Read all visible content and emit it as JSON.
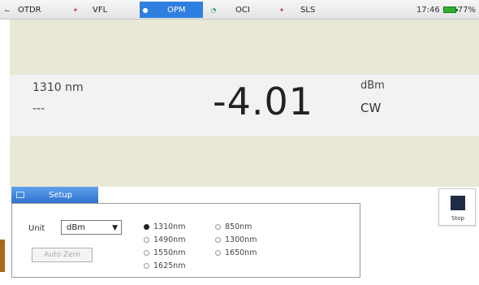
{
  "tabs": [
    {
      "label": "OTDR",
      "icon": "otdr-icon"
    },
    {
      "label": "VFL",
      "icon": "laser-icon"
    },
    {
      "label": "OPM",
      "icon": "power-meter-icon",
      "active": true
    },
    {
      "label": "OCI",
      "icon": "inspection-icon"
    },
    {
      "label": "SLS",
      "icon": "light-source-icon"
    }
  ],
  "status": {
    "time": "17:46",
    "battery": "77%"
  },
  "reading": {
    "wavelength": "1310 nm",
    "secondary": "---",
    "value": "-4.01",
    "unit": "dBm",
    "mode": "CW"
  },
  "setup": {
    "title": "Setup",
    "unit_label": "Unit",
    "unit_value": "dBm",
    "auto_zero": "Auto Zero",
    "wavelengths": [
      {
        "label": "1310nm",
        "checked": true
      },
      {
        "label": "1490nm",
        "checked": false
      },
      {
        "label": "1550nm",
        "checked": false
      },
      {
        "label": "1625nm",
        "checked": false
      },
      {
        "label": "850nm",
        "checked": false
      },
      {
        "label": "1300nm",
        "checked": false
      },
      {
        "label": "1650nm",
        "checked": false
      }
    ]
  },
  "controls": {
    "stop_label": "Stop"
  },
  "colors": {
    "accent": "#2f7fe0",
    "band": "#e9e7d6",
    "battery": "#2fb02f"
  }
}
